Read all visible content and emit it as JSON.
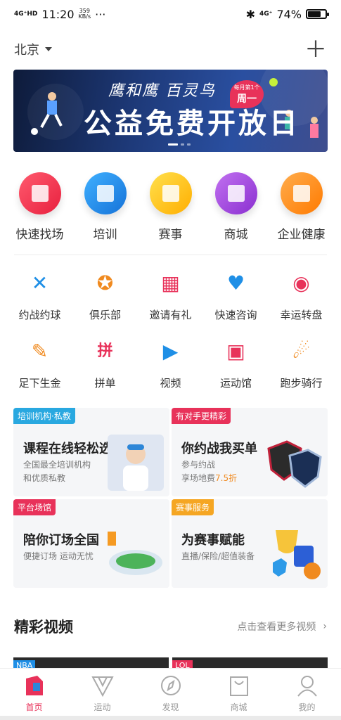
{
  "status": {
    "network": "4G⁺HD",
    "time": "11:20",
    "speed_value": "359",
    "speed_unit": "KB/s",
    "more": "···",
    "bluetooth": "✱",
    "net2": "4G⁺",
    "battery": "74%",
    "battery_level": 0.74
  },
  "header": {
    "city": "北京",
    "add_icon": "plus-icon"
  },
  "banner": {
    "subtitle": "鹰和鹰 百灵鸟",
    "title": "公益免费开放日",
    "bubble_top": "每月第1个",
    "bubble_main": "周一",
    "colors": [
      "#0e1b3a",
      "#2a4fa0"
    ]
  },
  "main_categories": [
    {
      "label": "快速找场",
      "icon": "lightning-icon",
      "color": "#f0334d"
    },
    {
      "label": "培训",
      "icon": "book-icon",
      "color": "#1f8fe6"
    },
    {
      "label": "赛事",
      "icon": "trophy-icon",
      "color": "#ffc31f"
    },
    {
      "label": "商城",
      "icon": "shopping-bag-icon",
      "color": "#a64bdc"
    },
    {
      "label": "企业健康",
      "icon": "briefcase-icon",
      "color": "#ff8a1f"
    }
  ],
  "grid": [
    {
      "label": "约战约球",
      "icon": "crossed-swords-icon",
      "glyph": "✕",
      "color": "#1f8fe6"
    },
    {
      "label": "俱乐部",
      "icon": "shield-star-icon",
      "glyph": "✪",
      "color": "#f08a1f"
    },
    {
      "label": "邀请有礼",
      "icon": "gift-icon",
      "glyph": "▦",
      "color": "#e8325a"
    },
    {
      "label": "快速咨询",
      "icon": "chat-heart-icon",
      "glyph": "♥",
      "color": "#1f8fe6"
    },
    {
      "label": "幸运转盘",
      "icon": "wheel-icon",
      "glyph": "◉",
      "color": "#e8325a"
    },
    {
      "label": "足下生金",
      "icon": "pen-coin-icon",
      "glyph": "✎",
      "color": "#f08a1f"
    },
    {
      "label": "拼单",
      "icon": "group-order-icon",
      "glyph": "拼",
      "color": "#e8325a"
    },
    {
      "label": "视频",
      "icon": "tv-play-icon",
      "glyph": "▶",
      "color": "#1f8fe6"
    },
    {
      "label": "运动馆",
      "icon": "stadium-icon",
      "glyph": "▣",
      "color": "#e8325a"
    },
    {
      "label": "跑步骑行",
      "icon": "runner-icon",
      "glyph": "☄",
      "color": "#f08a1f"
    }
  ],
  "cards": [
    {
      "tag": "培训机构·私教",
      "tag_color": "#29a8e0",
      "title": "课程在线轻松选",
      "desc1": "全国最全培训机构",
      "desc2": "和优质私教",
      "art_color": "#dfe6f2"
    },
    {
      "tag": "有对手更精彩",
      "tag_color": "#e8325a",
      "title": "你约战我买单",
      "desc1": "参与约战",
      "desc2_prefix": "享场地费",
      "desc2_highlight": "7.5折",
      "art_color": "#2d3a66"
    },
    {
      "tag": "平台场馆",
      "tag_color": "#e8325a",
      "title": "陪你订场全国",
      "desc1": "便捷订场 运动无忧",
      "art_color": "#cfe3d0"
    },
    {
      "tag": "赛事服务",
      "tag_color": "#f5a623",
      "title": "为赛事赋能",
      "desc1": "直播/保险/超值装备",
      "art_color": "#f6d37a"
    }
  ],
  "videos": {
    "heading": "精彩视频",
    "more": "点击查看更多视频",
    "thumbs": [
      {
        "badge": "NBA",
        "badge_color": "#1f8fe6"
      },
      {
        "badge": "LOL",
        "badge_color": "#e8325a"
      }
    ]
  },
  "tabs": [
    {
      "label": "首页",
      "icon": "home-icon",
      "active": true
    },
    {
      "label": "运动",
      "icon": "sport-v-icon",
      "active": false
    },
    {
      "label": "发现",
      "icon": "compass-icon",
      "active": false
    },
    {
      "label": "商城",
      "icon": "bag-icon",
      "active": false
    },
    {
      "label": "我的",
      "icon": "user-icon",
      "active": false
    }
  ]
}
